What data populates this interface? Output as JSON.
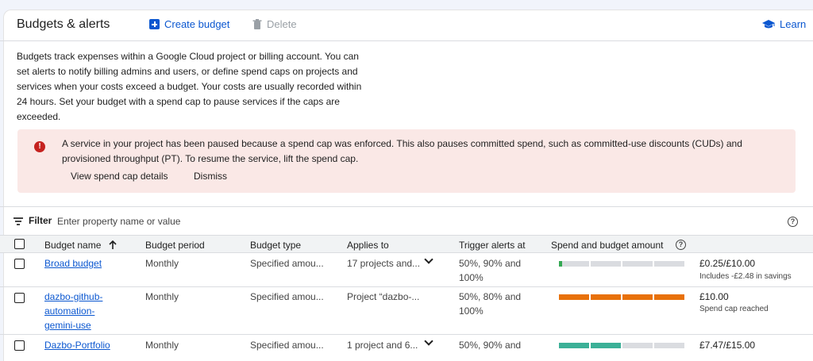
{
  "header": {
    "title": "Budgets & alerts",
    "create_label": "Create budget",
    "delete_label": "Delete",
    "learn_label": "Learn"
  },
  "description": "Budgets track expenses within a Google Cloud project or billing account. You can set alerts to notify billing admins and users, or define spend caps on projects and services when your costs exceed a budget. Your costs are usually recorded within 24 hours. Set your budget with a spend cap to pause services if the caps are exceeded.",
  "alert": {
    "message": "A service in your project has been paused because a spend cap was enforced. This also pauses committed spend, such as committed-use discounts (CUDs) and provisioned throughput (PT). To resume the service, lift the spend cap.",
    "action_details": "View spend cap details",
    "action_dismiss": "Dismiss"
  },
  "filter": {
    "label": "Filter",
    "placeholder": "Enter property name or value"
  },
  "table": {
    "headers": {
      "name": "Budget name",
      "period": "Budget period",
      "type": "Budget type",
      "applies": "Applies to",
      "trigger": "Trigger alerts at",
      "spend": "Spend and budget amount"
    },
    "rows": [
      {
        "name": "Broad budget",
        "period": "Monthly",
        "type": "Specified amou...",
        "applies": "17 projects and...",
        "trigger": "50%, 90% and 100%",
        "amount": "£0.25/£10.00",
        "note": "Includes -£2.48 in savings",
        "progress": 0.025,
        "bar_color": "#34a853"
      },
      {
        "name": "dazbo-github-automation-gemini-use",
        "period": "Monthly",
        "type": "Specified amou...",
        "applies": "Project “dazbo-...",
        "trigger": "50%, 80% and 100%",
        "amount": "£10.00",
        "note": "Spend cap reached",
        "progress": 1.0,
        "bar_color": "#e8710a"
      },
      {
        "name": "Dazbo-Portfolio",
        "period": "Monthly",
        "type": "Specified amou...",
        "applies": "1 project and 6...",
        "trigger": "50%, 90% and",
        "amount": "£7.47/£15.00",
        "note": "",
        "progress": 0.498,
        "bar_color": "#3bb097"
      }
    ]
  }
}
